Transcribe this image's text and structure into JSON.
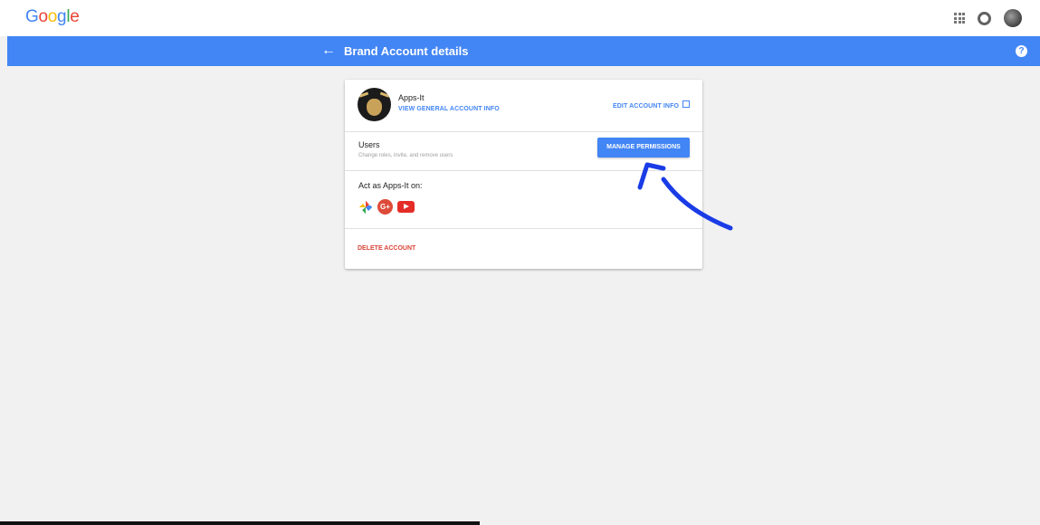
{
  "brand": {
    "logo_letters": [
      {
        "char": "G",
        "color": "#4285f4"
      },
      {
        "char": "o",
        "color": "#ea4335"
      },
      {
        "char": "o",
        "color": "#fbbc05"
      },
      {
        "char": "g",
        "color": "#4285f4"
      },
      {
        "char": "l",
        "color": "#34a853"
      },
      {
        "char": "e",
        "color": "#ea4335"
      }
    ]
  },
  "topbar": {
    "icons": [
      "apps-grid-icon",
      "notifications-ring-icon",
      "profile-avatar"
    ]
  },
  "header": {
    "back_icon": "←",
    "title": "Brand Account details",
    "help_icon": "?",
    "color": "#4285f4"
  },
  "account": {
    "name": "Apps-It",
    "view_info_label": "VIEW GENERAL ACCOUNT INFO",
    "edit_info_label": "EDIT ACCOUNT INFO"
  },
  "users": {
    "label": "Users",
    "description": "Change roles, invite, and remove users",
    "manage_button": "MANAGE PERMISSIONS"
  },
  "act_as": {
    "label": "Act as Apps-It on:",
    "services": [
      "google-photos-icon",
      "google-plus-icon",
      "youtube-icon"
    ],
    "gplus_text": "G+"
  },
  "delete": {
    "label": "DELETE ACCOUNT",
    "color": "#db4437"
  },
  "annotation": {
    "color": "#1a3ce6",
    "description_icon": "hand-drawn-arrow"
  }
}
